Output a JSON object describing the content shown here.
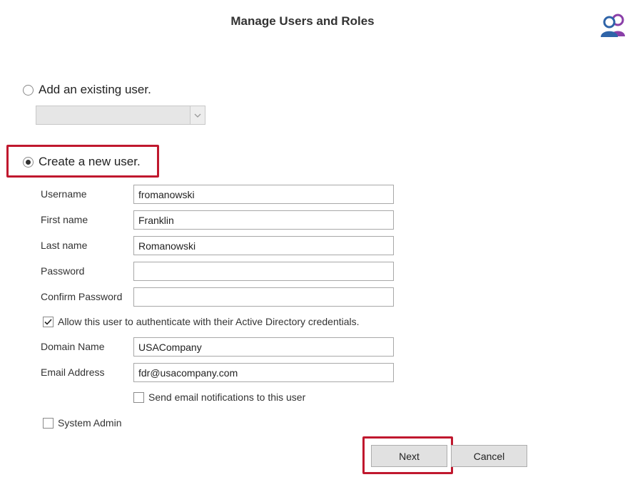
{
  "header": {
    "title": "Manage Users and Roles",
    "icon": "users-icon"
  },
  "existing_user": {
    "radio_label": "Add an existing user.",
    "selected": false,
    "dropdown_value": ""
  },
  "new_user": {
    "radio_label": "Create a new user.",
    "selected": true
  },
  "form": {
    "username": {
      "label": "Username",
      "value": "fromanowski"
    },
    "first_name": {
      "label": "First name",
      "value": "Franklin"
    },
    "last_name": {
      "label": "Last name",
      "value": "Romanowski"
    },
    "password": {
      "label": "Password",
      "value": ""
    },
    "confirm_password": {
      "label": "Confirm Password",
      "value": ""
    },
    "ad_auth": {
      "label": "Allow this user to authenticate with their Active Directory credentials.",
      "checked": true
    },
    "domain_name": {
      "label": "Domain Name",
      "value": "USACompany"
    },
    "email_address": {
      "label": "Email Address",
      "value": "fdr@usacompany.com"
    },
    "send_email": {
      "label": "Send email notifications to this user",
      "checked": false
    },
    "system_admin": {
      "label": "System Admin",
      "checked": false
    }
  },
  "buttons": {
    "next": "Next",
    "cancel": "Cancel"
  },
  "colors": {
    "highlight": "#c0182e",
    "icon_blue": "#2f64a8",
    "icon_purple": "#8a3fa8"
  }
}
